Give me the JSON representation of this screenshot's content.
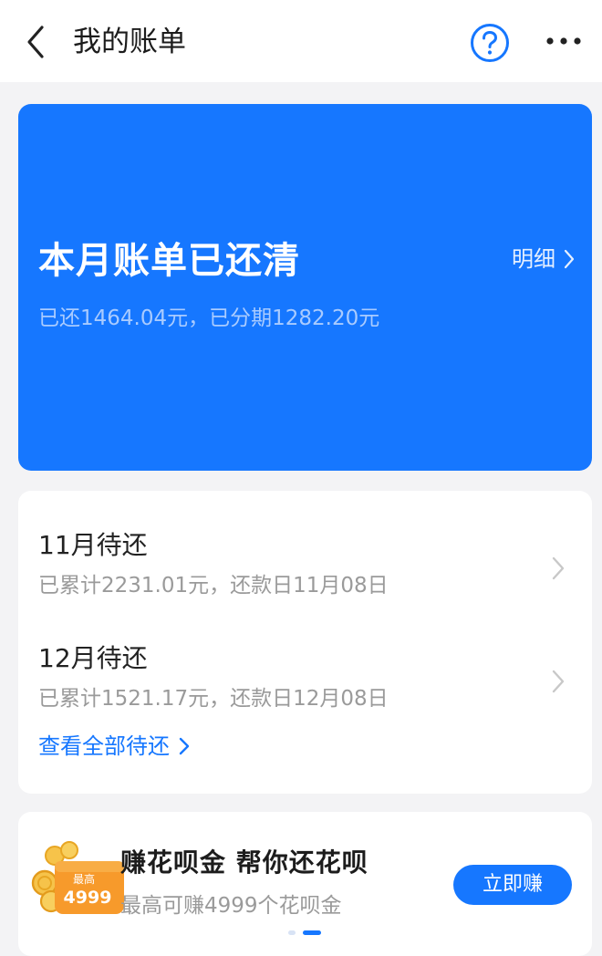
{
  "header": {
    "title": "我的账单",
    "back_icon": "chevron-left-icon",
    "help_icon": "question-circle-icon",
    "more_icon": "more-dots-icon"
  },
  "hero": {
    "title": "本月账单已还清",
    "subtitle": "已还1464.04元，已分期1282.20元",
    "detail_label": "明细",
    "bg_color": "#1677ff"
  },
  "bills": {
    "items": [
      {
        "title": "11月待还",
        "subtitle": "已累计2231.01元，还款日11月08日"
      },
      {
        "title": "12月待还",
        "subtitle": "已累计1521.17元，还款日12月08日"
      }
    ],
    "view_all": "查看全部待还"
  },
  "promo": {
    "badge_top": "最高",
    "badge_value": "4999",
    "title": "赚花呗金   帮你还花呗",
    "subtitle": "最高可赚4999个花呗金",
    "button": "立即赚"
  }
}
